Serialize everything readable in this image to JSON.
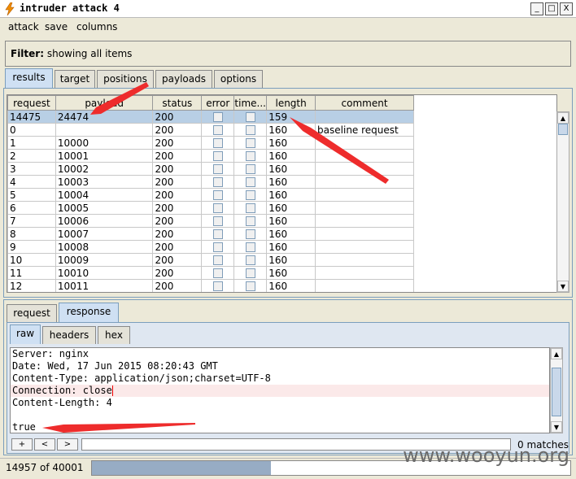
{
  "window": {
    "title": "intruder attack 4",
    "min": "_",
    "max": "□",
    "close": "X"
  },
  "menu": [
    "attack",
    "save",
    "columns"
  ],
  "filter": {
    "label": "Filter:",
    "value": "showing all items"
  },
  "main_tabs": [
    "results",
    "target",
    "positions",
    "payloads",
    "options"
  ],
  "table": {
    "headers": [
      "request",
      "payload",
      "status",
      "error",
      "time...",
      "length",
      "comment"
    ],
    "rows": [
      [
        "14475",
        "24474",
        "200",
        "",
        "",
        "159",
        ""
      ],
      [
        "0",
        "",
        "200",
        "",
        "",
        "160",
        "baseline request"
      ],
      [
        "1",
        "10000",
        "200",
        "",
        "",
        "160",
        ""
      ],
      [
        "2",
        "10001",
        "200",
        "",
        "",
        "160",
        ""
      ],
      [
        "3",
        "10002",
        "200",
        "",
        "",
        "160",
        ""
      ],
      [
        "4",
        "10003",
        "200",
        "",
        "",
        "160",
        ""
      ],
      [
        "5",
        "10004",
        "200",
        "",
        "",
        "160",
        ""
      ],
      [
        "6",
        "10005",
        "200",
        "",
        "",
        "160",
        ""
      ],
      [
        "7",
        "10006",
        "200",
        "",
        "",
        "160",
        ""
      ],
      [
        "8",
        "10007",
        "200",
        "",
        "",
        "160",
        ""
      ],
      [
        "9",
        "10008",
        "200",
        "",
        "",
        "160",
        ""
      ],
      [
        "10",
        "10009",
        "200",
        "",
        "",
        "160",
        ""
      ],
      [
        "11",
        "10010",
        "200",
        "",
        "",
        "160",
        ""
      ],
      [
        "12",
        "10011",
        "200",
        "",
        "",
        "160",
        ""
      ]
    ]
  },
  "detail_tabs": [
    "request",
    "response"
  ],
  "view_tabs": [
    "raw",
    "headers",
    "hex"
  ],
  "response_lines": [
    "Server: nginx",
    "Date: Wed, 17 Jun 2015 08:20:43 GMT",
    "Content-Type: application/json;charset=UTF-8",
    "Connection: close",
    "Content-Length: 4",
    "",
    "true"
  ],
  "search": {
    "plus": "+",
    "prev": "<",
    "next": ">",
    "matches": "0 matches"
  },
  "status": {
    "text": "14957 of 40001",
    "progress_fraction": 0.374
  },
  "watermark": "www.wooyun.org",
  "colors": {
    "selection": "#b8cfe5",
    "tab_active": "#cfe0f3",
    "annotation_arrow": "#ee2c2c",
    "progress": "#97acc4"
  }
}
